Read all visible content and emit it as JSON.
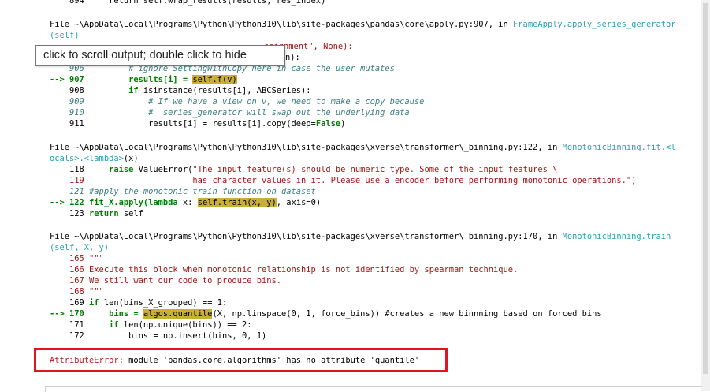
{
  "tooltip": {
    "text": "click to scroll output; double click to hide"
  },
  "frame_top": {
    "line_894": "    894     return self.wrap_results(results, res_index)"
  },
  "frame_apply": {
    "file_prefix": "File ~\\AppData\\Local\\Programs\\Python\\Python310\\lib\\site-packages\\pandas\\core\\apply.py:907, in ",
    "func": "FrameApply.apply_series_generator",
    "args": "(self)",
    "partial_a": "ssignment\", None):",
    "partial_b": "n):",
    "line_906": "    906         # ignore SettingWithCopy here in case the user mutates",
    "arrow_907_pre": "--> 907         results[i] = ",
    "arrow_907_hl": "self.f(v)",
    "line_908_a": "    908         ",
    "line_908_kw": "if",
    "line_908_b": " isinstance(results[i], ABCSeries):",
    "line_909": "    909             # If we have a view on v, we need to make a copy because",
    "line_910": "    910             #  series_generator will swap out the underlying data",
    "line_911_a": "    911             results[i] = results[i].copy(deep=",
    "line_911_kw": "False",
    "line_911_b": ")"
  },
  "frame_binning_fit": {
    "file_prefix": "File ~\\AppData\\Local\\Programs\\Python\\Python310\\lib\\site-packages\\xverse\\transformer\\_binning.py:122, in ",
    "func_a": "MonotonicBinning.fit.<l",
    "func_b": "ocals>.<lambda>",
    "args": "(x)",
    "line_118_a": "    118     ",
    "line_118_kw": "raise",
    "line_118_b": " ValueError(",
    "line_118_str": "\"The input feature(s) should be numeric type. Some of the input features \\",
    "line_119_str": "    119                      has character values in it. Please use a encoder before performing monotonic operations.\")",
    "line_121": "    121 #apply the monotonic train function on dataset",
    "arrow_122_pre": "--> 122 fit_X.apply(",
    "arrow_122_kw": "lambda",
    "arrow_122_mid": " x: ",
    "arrow_122_hl": "self.train(x, y)",
    "arrow_122_post": ", axis=0)",
    "line_123_a": "    123 ",
    "line_123_kw": "return",
    "line_123_b": " self"
  },
  "frame_binning_train": {
    "file_prefix": "File ~\\AppData\\Local\\Programs\\Python\\Python310\\lib\\site-packages\\xverse\\transformer\\_binning.py:170, in ",
    "func": "MonotonicBinning.train",
    "args": "(self, X, y)",
    "line_165": "    165 \"\"\"",
    "line_166": "    166 Execute this block when monotonic relationship is not identified by spearman technique.",
    "line_167": "    167 We still want our code to produce bins.",
    "line_168": "    168 \"\"\"",
    "line_169_a": "    169 ",
    "line_169_kw": "if",
    "line_169_b": " len(bins_X_grouped) == 1:",
    "arrow_170_pre": "--> 170     bins = ",
    "arrow_170_hl": "algos.quantile",
    "arrow_170_post": "(X, np.linspace(0, 1, force_bins)) #creates a new binnning based on forced bins",
    "line_171_a": "    171     ",
    "line_171_kw": "if",
    "line_171_b": " len(np.unique(bins)) == 2:",
    "line_172": "    172         bins = np.insert(bins, 0, 1)"
  },
  "error": {
    "name": "AttributeError",
    "message": ": module 'pandas.core.algorithms' has no attribute 'quantile'"
  },
  "colors": {
    "highlight": "#c9b035",
    "error_box": "#e0141e",
    "func_link": "#2aa1b3",
    "arrow": "#008000"
  }
}
